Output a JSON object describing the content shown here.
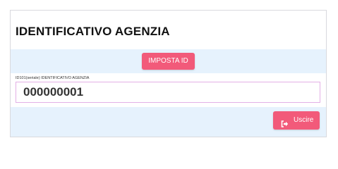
{
  "panel": {
    "title": "IDENTIFICATIVO AGENZIA"
  },
  "actions": {
    "set_id_label": "IMPOSTA ID",
    "exit_label": "Uscire",
    "exit_icon": "sign-out-icon"
  },
  "field": {
    "label": "ID101(seriale) IDENTIFICATIVO AGENZIA",
    "value": "000000001"
  },
  "colors": {
    "button": "#f25a7a",
    "band": "#e6f2fd",
    "input_border": "#e3b0e6"
  }
}
